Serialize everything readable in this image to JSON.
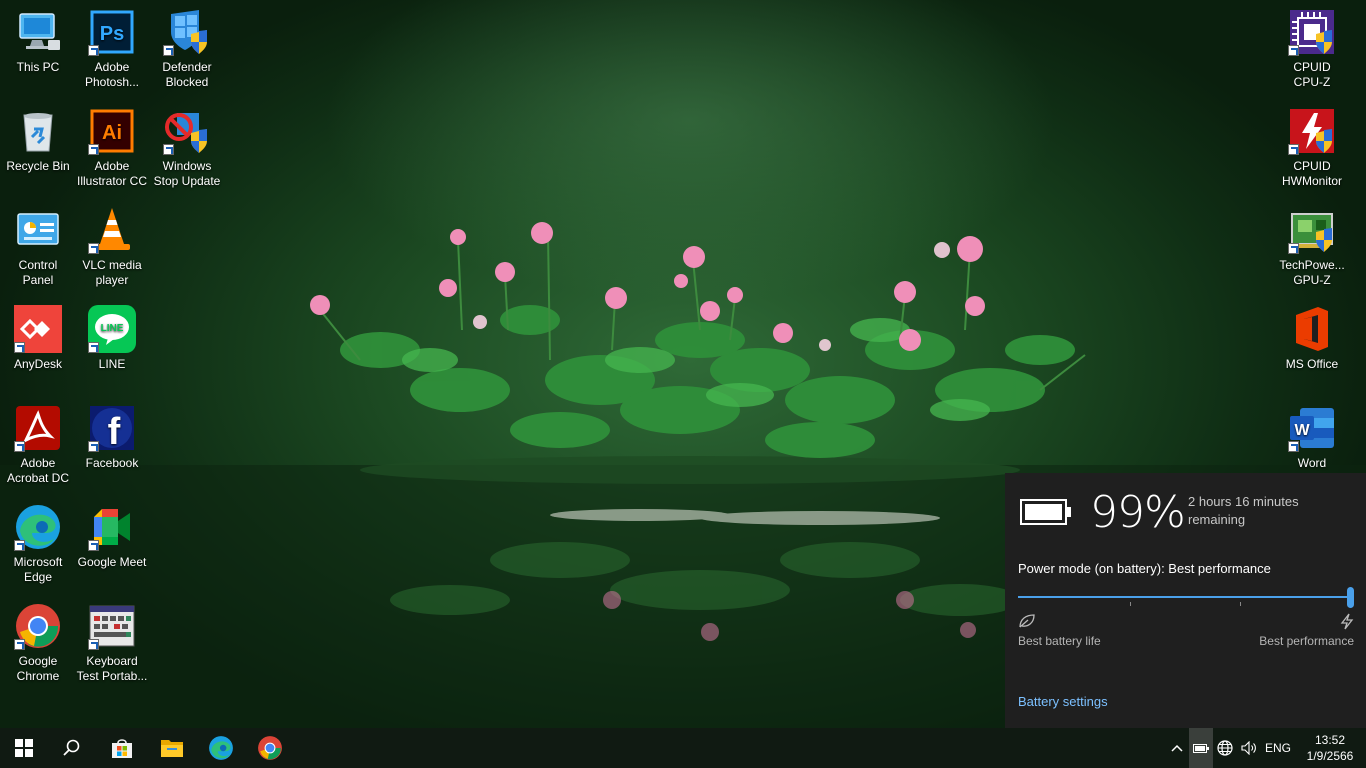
{
  "desktop": {
    "icons_left": [
      {
        "label": "This PC",
        "icon": "this-pc-icon"
      },
      {
        "label": "Adobe\nPhotosh...",
        "icon": "photoshop-icon",
        "text": "Ps"
      },
      {
        "label": "Defender\nBlocked",
        "icon": "defender-blocked-icon"
      },
      {
        "label": "Recycle Bin",
        "icon": "recycle-bin-icon"
      },
      {
        "label": "Adobe\nIllustrator CC",
        "icon": "illustrator-icon",
        "text": "Ai"
      },
      {
        "label": "Windows\nStop Update",
        "icon": "windows-stop-update-icon"
      },
      {
        "label": "Control\nPanel",
        "icon": "control-panel-icon"
      },
      {
        "label": "VLC media\nplayer",
        "icon": "vlc-icon"
      },
      {
        "label": "AnyDesk",
        "icon": "anydesk-icon"
      },
      {
        "label": "LINE",
        "icon": "line-icon",
        "text": "LINE"
      },
      {
        "label": "Adobe\nAcrobat DC",
        "icon": "acrobat-icon"
      },
      {
        "label": "Facebook",
        "icon": "facebook-icon",
        "text": "f"
      },
      {
        "label": "Microsoft\nEdge",
        "icon": "edge-icon"
      },
      {
        "label": "Google Meet",
        "icon": "google-meet-icon"
      },
      {
        "label": "Google\nChrome",
        "icon": "chrome-icon"
      },
      {
        "label": "Keyboard\nTest Portab...",
        "icon": "keyboard-test-icon"
      }
    ],
    "icons_right": [
      {
        "label": "CPUID\nCPU-Z",
        "icon": "cpu-z-icon"
      },
      {
        "label": "CPUID\nHWMonitor",
        "icon": "hwmonitor-icon"
      },
      {
        "label": "TechPowe...\nGPU-Z",
        "icon": "gpu-z-icon"
      },
      {
        "label": "MS Office",
        "icon": "ms-office-icon"
      },
      {
        "label": "Word",
        "icon": "word-icon",
        "text": "W"
      }
    ]
  },
  "battery_flyout": {
    "percent": "99%",
    "remaining": "2 hours 16 minutes remaining",
    "power_mode_label": "Power mode (on battery): Best performance",
    "slider_level": 1.0,
    "min_label": "Best battery life",
    "max_label": "Best performance",
    "settings_link": "Battery settings"
  },
  "taskbar": {
    "pinned": [
      "start-button",
      "search-button",
      "microsoft-store-icon",
      "file-explorer-icon",
      "edge-icon",
      "chrome-icon"
    ],
    "tray": {
      "language": "ENG",
      "time": "13:52",
      "date": "1/9/2566"
    }
  },
  "colors": {
    "accent": "#4aa0ea",
    "flyout_bg": "#1f1f1f",
    "taskbar_bg": "#101a12"
  }
}
